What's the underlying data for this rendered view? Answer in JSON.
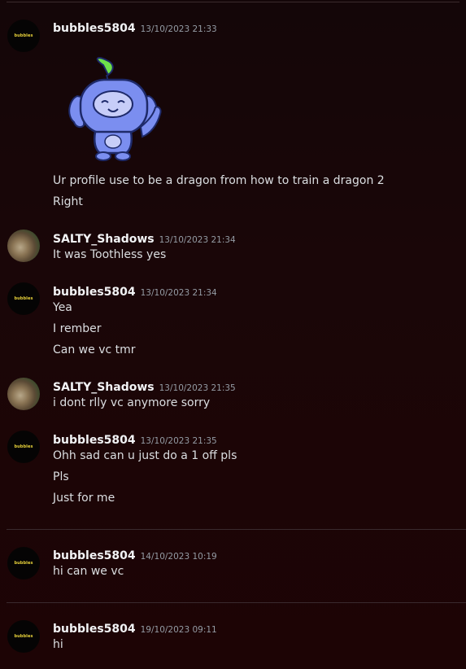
{
  "messages": [
    {
      "username": "bubbles5804",
      "timestamp": "13/10/2023 21:33",
      "avatar_text": "bubbles",
      "sticker": "wumpus-waving-sticker",
      "lines": [
        "Ur profile use to be a dragon from how to train a dragon 2",
        "Right"
      ]
    },
    {
      "username": "SALTY_Shadows",
      "timestamp": "13/10/2023 21:34",
      "lines": [
        "It was Toothless yes"
      ]
    },
    {
      "username": "bubbles5804",
      "timestamp": "13/10/2023 21:34",
      "avatar_text": "bubbles",
      "lines": [
        "Yea",
        "I rember",
        "Can we vc tmr"
      ]
    },
    {
      "username": "SALTY_Shadows",
      "timestamp": "13/10/2023 21:35",
      "lines": [
        "i dont rlly vc anymore sorry"
      ]
    },
    {
      "username": "bubbles5804",
      "timestamp": "13/10/2023 21:35",
      "avatar_text": "bubbles",
      "lines": [
        "Ohh sad can u just do a 1 off pls",
        "Pls",
        "Just for me"
      ]
    },
    {
      "username": "bubbles5804",
      "timestamp": "14/10/2023 10:19",
      "avatar_text": "bubbles",
      "lines": [
        "hi can we vc"
      ]
    },
    {
      "username": "bubbles5804",
      "timestamp": "19/10/2023 09:11",
      "avatar_text": "bubbles",
      "lines": [
        "hi"
      ]
    }
  ],
  "colors": {
    "background_top": "#140608",
    "background_bottom": "#1d0405",
    "username": "#f2f3f5",
    "timestamp": "#949ba4",
    "message_text": "#dbdee1",
    "sticker_body": "#7b8ef0",
    "sticker_leaf": "#6ee04a"
  }
}
